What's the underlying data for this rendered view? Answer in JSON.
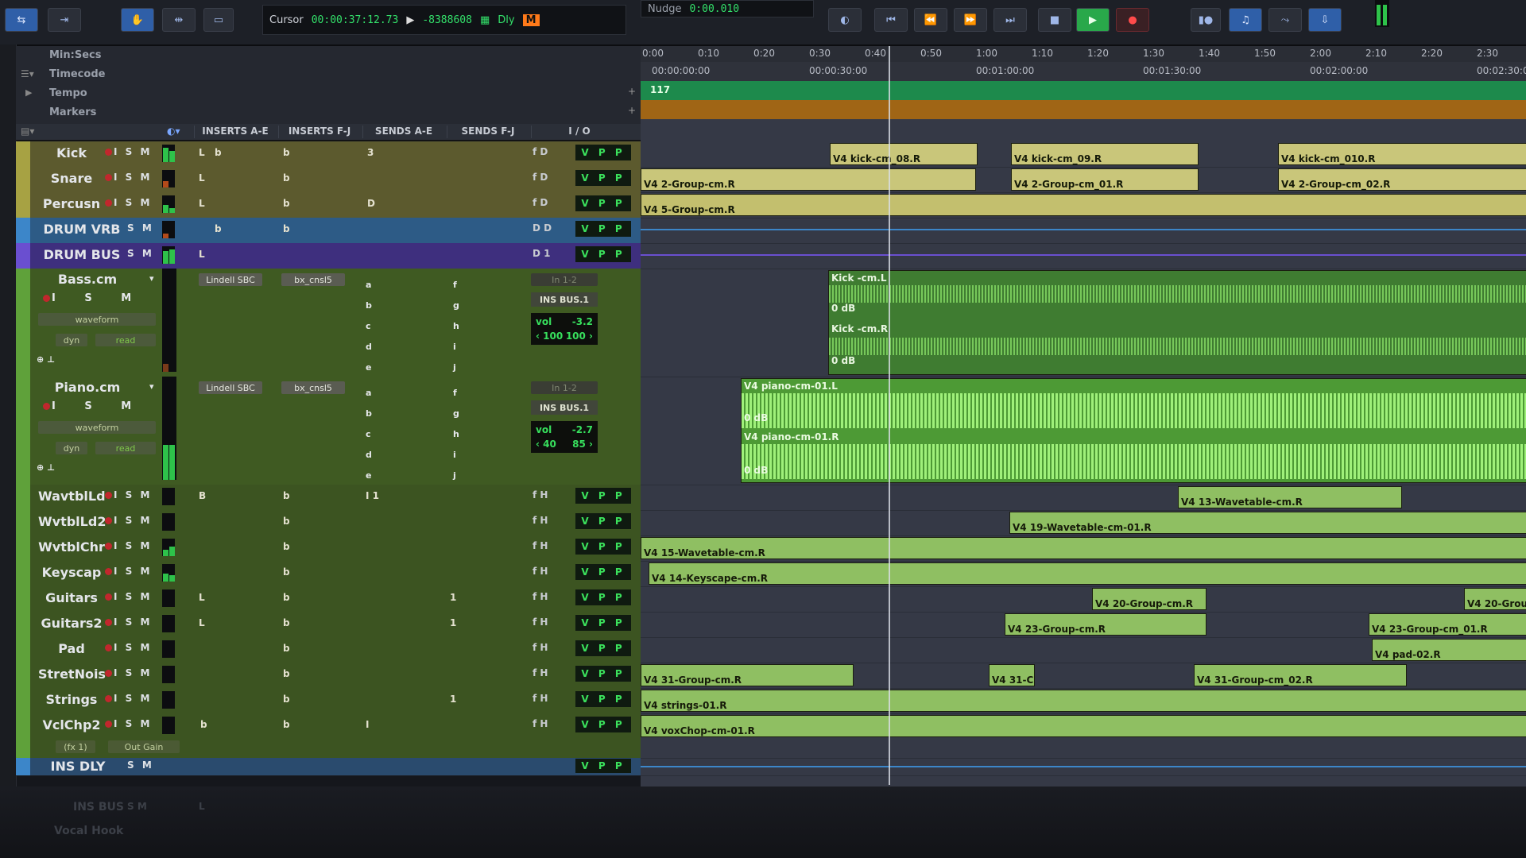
{
  "toolbar": {
    "cursor_label": "Cursor",
    "cursor_time": "00:00:37:12.73",
    "cursor_value": "-8388608",
    "dly_label": "Dly",
    "nudge_label": "Nudge",
    "nudge_value": "0:00.010",
    "m_label": "M"
  },
  "rulers": {
    "minsecs": "Min:Secs",
    "timecode": "Timecode",
    "tempo": "Tempo",
    "markers": "Markers",
    "tempo_value": "117"
  },
  "columns": [
    "INSERTS A-E",
    "INSERTS F-J",
    "SENDS A-E",
    "SENDS F-J",
    "I / O"
  ],
  "timeline": {
    "minsecs_ticks": [
      "0:00",
      "0:10",
      "0:20",
      "0:30",
      "0:40",
      "0:50",
      "1:00",
      "1:10",
      "1:20",
      "1:30",
      "1:40",
      "1:50",
      "2:00",
      "2:10",
      "2:20",
      "2:30"
    ],
    "timecode_ticks": [
      "00:00:00:00",
      "00:00:30:00",
      "00:01:00:00",
      "00:01:30:00",
      "00:02:00:00",
      "00:02:30:0"
    ]
  },
  "tracks": {
    "kick": {
      "name": "Kick",
      "btns": "I S M",
      "ins_a": "L",
      "ins_b": "b",
      "ins_c": "b",
      "send": "3",
      "io": "f D",
      "vpp": "V P P"
    },
    "snare": {
      "name": "Snare",
      "btns": "I S M",
      "ins_a": "L",
      "ins_c": "b",
      "io": "f D",
      "vpp": "V P P"
    },
    "percusn": {
      "name": "Percusn",
      "btns": "I S M",
      "ins_a": "L",
      "ins_c": "b",
      "send": "D",
      "io": "f D",
      "vpp": "V P P"
    },
    "drumvrb": {
      "name": "DRUM VRB",
      "btns": "S M",
      "ins_b": "b",
      "ins_c": "b",
      "io": "D D",
      "vpp": "V P P"
    },
    "drumbus": {
      "name": "DRUM BUS",
      "btns": "S M",
      "ins_a": "L",
      "io": "D 1",
      "vpp": "V P P"
    },
    "bass": {
      "name": "Bass.cm",
      "ins1": "Lindell SBC",
      "ins2": "bx_cnsl5",
      "mode": "waveform",
      "dyn": "dyn",
      "read": "read",
      "input": "In 1-2",
      "bus": "INS BUS.1",
      "vol_label": "vol",
      "vol": "-3.2",
      "pan_l": "‹ 100",
      "pan_r": "100 ›"
    },
    "piano": {
      "name": "Piano.cm",
      "ins1": "Lindell SBC",
      "ins2": "bx_cnsl5",
      "mode": "waveform",
      "dyn": "dyn",
      "read": "read",
      "input": "In 1-2",
      "bus": "INS BUS.1",
      "vol_label": "vol",
      "vol": "-2.7",
      "pan_l": "‹ 40",
      "pan_r": "85 ›"
    },
    "wavtbild": {
      "name": "WavtblLd",
      "btns": "I S M",
      "ins_a": "B",
      "ins_c": "b",
      "send": "I 1",
      "io": "f H",
      "vpp": "V P P"
    },
    "wvtbild2": {
      "name": "WvtblLd2",
      "btns": "I S M",
      "ins_c": "b",
      "io": "f H",
      "vpp": "V P P"
    },
    "wvtblchr": {
      "name": "WvtblChr",
      "btns": "I S M",
      "ins_c": "b",
      "io": "f H",
      "vpp": "V P P"
    },
    "keyscap": {
      "name": "Keyscap",
      "btns": "I S M",
      "ins_c": "b",
      "io": "f H",
      "vpp": "V P P"
    },
    "guitars": {
      "name": "Guitars",
      "btns": "I S M",
      "ins_a": "L",
      "ins_c": "b",
      "send2": "1",
      "io": "f H",
      "vpp": "V P P"
    },
    "guitars2": {
      "name": "Guitars2",
      "btns": "I S M",
      "ins_a": "L",
      "ins_c": "b",
      "send2": "1",
      "io": "f H",
      "vpp": "V P P"
    },
    "pad": {
      "name": "Pad",
      "btns": "I S M",
      "ins_c": "b",
      "io": "f H",
      "vpp": "V P P"
    },
    "stretnois": {
      "name": "StretNois",
      "btns": "I S M",
      "ins_c": "b",
      "io": "f H",
      "vpp": "V P P"
    },
    "strings": {
      "name": "Strings",
      "btns": "I S M",
      "ins_c": "b",
      "send2": "1",
      "io": "f H",
      "vpp": "V P P"
    },
    "vclchp2": {
      "name": "VclChp2",
      "btns": "I S M",
      "ins_a": "b",
      "ins_c": "b",
      "send": "I",
      "io": "f H",
      "vpp": "V P P",
      "fx": "(fx 1)",
      "outgain": "Out Gain"
    },
    "insdly": {
      "name": "INS DLY",
      "btns": "S M",
      "vpp": "V P P"
    },
    "insbus": {
      "name": "INS BUS",
      "btns": "S M",
      "ins_a": "L"
    },
    "vocalhook": {
      "name": "Vocal Hook"
    }
  },
  "clips": {
    "kick1": "V4 kick-cm_08.R",
    "kick2": "V4 kick-cm_09.R",
    "kick3": "V4 kick-cm_010.R",
    "snare1": "V4 2-Group-cm.R",
    "snare2": "V4 2-Group-cm_01.R",
    "snare3": "V4 2-Group-cm_02.R",
    "perc1": "V4 5-Group-cm.R",
    "bassL": "Kick -cm.L",
    "bassR": "Kick -cm.R",
    "gain": "0 dB",
    "pianoL": "V4 piano-cm-01.L",
    "pianoR": "V4 piano-cm-01.R",
    "wav13": "V4 13-Wavetable-cm.R",
    "wav19": "V4 19-Wavetable-cm-01.R",
    "wav15": "V4 15-Wavetable-cm.R",
    "key14": "V4 14-Keyscape-cm.R",
    "g20a": "V4 20-Group-cm.R",
    "g20b": "V4 20-Grou",
    "g23a": "V4 23-Group-cm.R",
    "g23b": "V4 23-Group-cm_01.R",
    "pad02": "V4 pad-02.R",
    "g31a": "V4 31-Group-cm.R",
    "g31b": "V4 31-C",
    "g31c": "V4 31-Group-cm_02.R",
    "strings": "V4 strings-01.R",
    "voxchop": "V4 voxChop-cm-01.R"
  }
}
